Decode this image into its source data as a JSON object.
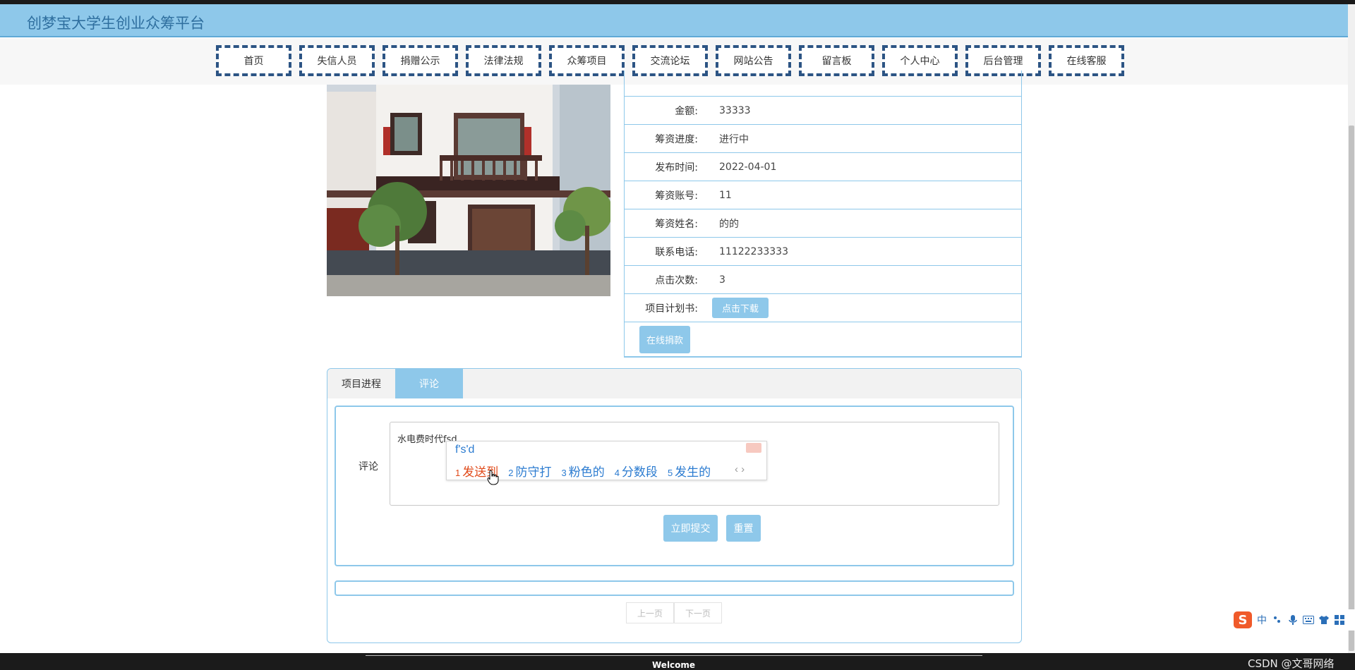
{
  "site": {
    "title": "创梦宝大学生创业众筹平台"
  },
  "nav": [
    {
      "label": "首页"
    },
    {
      "label": "失信人员"
    },
    {
      "label": "捐赠公示"
    },
    {
      "label": "法律法规"
    },
    {
      "label": "众筹项目"
    },
    {
      "label": "交流论坛"
    },
    {
      "label": "网站公告"
    },
    {
      "label": "留言板"
    },
    {
      "label": "个人中心"
    },
    {
      "label": "后台管理"
    },
    {
      "label": "在线客服"
    }
  ],
  "details": {
    "rows": [
      {
        "label": "金额:",
        "value": "33333"
      },
      {
        "label": "筹资进度:",
        "value": "进行中"
      },
      {
        "label": "发布时间:",
        "value": "2022-04-01"
      },
      {
        "label": "筹资账号:",
        "value": "11"
      },
      {
        "label": "筹资姓名:",
        "value": "的的"
      },
      {
        "label": "联系电话:",
        "value": "11122233333"
      },
      {
        "label": "点击次数:",
        "value": "3"
      }
    ],
    "plan_label": "项目计划书:",
    "download_label": "点击下载",
    "donate_label": "在线捐款"
  },
  "tabs": [
    {
      "label": "项目进程"
    },
    {
      "label": "评论"
    }
  ],
  "comment": {
    "label": "评论",
    "value": "水电费时代fsd",
    "submit_label": "立即提交",
    "reset_label": "重置"
  },
  "ime": {
    "input": "f's'd",
    "candidates": [
      {
        "num": "1",
        "text": "发送到"
      },
      {
        "num": "2",
        "text": "防守打"
      },
      {
        "num": "3",
        "text": "粉色的"
      },
      {
        "num": "4",
        "text": "分数段"
      },
      {
        "num": "5",
        "text": "发生的"
      }
    ],
    "arrows": "‹ ›"
  },
  "pager": {
    "prev_label": "上一页",
    "next_label": "下一页"
  },
  "taskbar": {
    "welcome": "Welcome",
    "watermark": "CSDN @文哥网络"
  },
  "ime_toolbar": {
    "logo": "S",
    "mode": "中"
  },
  "colors": {
    "accent": "#8ec8ea",
    "nav_border": "#2c5484",
    "title": "#2f6f9f",
    "ime_highlight": "#e04a1a",
    "ime_candidate": "#2b7bd0"
  }
}
